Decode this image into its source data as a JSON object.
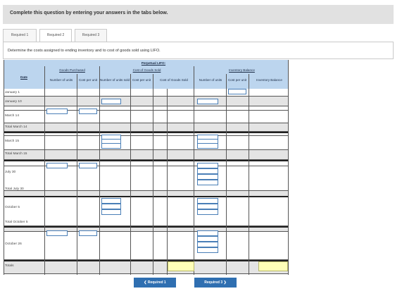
{
  "instruction": "Complete this question by entering your answers in the tabs below.",
  "tabs": [
    {
      "label": "Required 1",
      "active": false
    },
    {
      "label": "Required 2",
      "active": true
    },
    {
      "label": "Required 3",
      "active": false
    }
  ],
  "prompt": "Determine the costs assigned to ending inventory and to cost of goods sold using LIFO.",
  "table": {
    "title": "Perpetual LIFO:",
    "date_header": "Date",
    "groups": {
      "purchased": "Goods Purchased",
      "cogs": "Cost of Goods Sold",
      "inventory": "Inventory Balance"
    },
    "columns": {
      "p_units": "Number of units",
      "p_cost": "Cost per unit",
      "s_units": "Number of units sold",
      "s_cost": "Cost per unit",
      "s_total": "Cost of Goods Sold",
      "i_units": "Number of units",
      "i_cost": "Cost per unit",
      "i_bal": "Inventory Balance"
    },
    "rows": [
      "January 1",
      "January 10",
      "March 14",
      "Total March 14",
      "March 15",
      "Total March 15",
      "July 30",
      "Total July 30",
      "October 5",
      "Total October 5",
      "October 26",
      "Totals"
    ]
  },
  "nav": {
    "prev_label": "❮  Required 1",
    "next_label": "Required 3  ❯"
  },
  "colors": {
    "header_band": "#bcd5ee",
    "button": "#2f6fb1",
    "highlight": "#ffffb8"
  }
}
